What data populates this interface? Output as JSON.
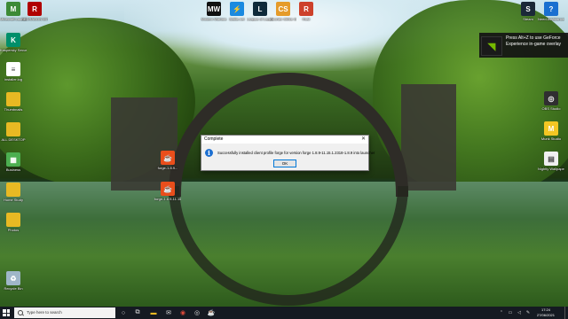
{
  "desktop": {
    "icons_left": [
      {
        "label": "Minecraft Launcher",
        "color": "#3c8a36",
        "glyph": "M"
      },
      {
        "label": "REDRAGON M711",
        "color": "#b00000",
        "glyph": "R"
      },
      {
        "label": "Kaspersky Security...",
        "color": "#008f6a",
        "glyph": "K"
      },
      {
        "label": "installer.log",
        "color": "#ffffff",
        "glyph": "≡"
      },
      {
        "label": "Thumbnails",
        "color": "#e8b923",
        "glyph": ""
      },
      {
        "label": "ALL DESKTOP",
        "color": "#e8b923",
        "glyph": ""
      },
      {
        "label": "Business",
        "color": "#4caf50",
        "glyph": "▦"
      },
      {
        "label": "Home Study",
        "color": "#e8b923",
        "glyph": ""
      },
      {
        "label": "Photos",
        "color": "#e8b923",
        "glyph": ""
      },
      {
        "label": "Recycle Bin",
        "color": "#9fb6c8",
        "glyph": "♻"
      }
    ],
    "icons_top": [
      {
        "label": "Modern Warfare",
        "color": "#111111",
        "glyph": "MW"
      },
      {
        "label": "Battle.net",
        "color": "#1a8ae0",
        "glyph": "⚡"
      },
      {
        "label": "League of Legends",
        "color": "#0e2a3a",
        "glyph": "L"
      },
      {
        "label": "Counter-Strike Global Offe...",
        "color": "#e59b2a",
        "glyph": "CS"
      },
      {
        "label": "Rust",
        "color": "#cd412b",
        "glyph": "R"
      }
    ],
    "icons_mid": [
      {
        "label": "forge-1.8.9...",
        "color": "#e94e1b",
        "glyph": "☕"
      },
      {
        "label": "forge-1.8.9-11.15...",
        "color": "#e94e1b",
        "glyph": "☕"
      }
    ],
    "icons_right": [
      {
        "label": "Steam",
        "color": "#1b2838",
        "glyph": "S"
      },
      {
        "label": "Need Assistance?",
        "color": "#1a6fd0",
        "glyph": "?"
      },
      {
        "label": "OBS Studio",
        "color": "#302e31",
        "glyph": "◎"
      },
      {
        "label": "Munk Studio",
        "color": "#f3c623",
        "glyph": "M"
      },
      {
        "label": "Nightly Wallpaper",
        "color": "#f0f0f0",
        "glyph": "▤"
      }
    ]
  },
  "dialog": {
    "title": "Complete",
    "message": "Successfully installed client profile forge for version forge 1.8.9-11.15.1.2318-1.8.9 into launcher",
    "ok_label": "OK"
  },
  "toast": {
    "text": "Press Alt+Z to use GeForce Experience in-game overlay"
  },
  "taskbar": {
    "search_placeholder": "Type here to search",
    "time": "17:24",
    "date": "27/06/2021"
  }
}
